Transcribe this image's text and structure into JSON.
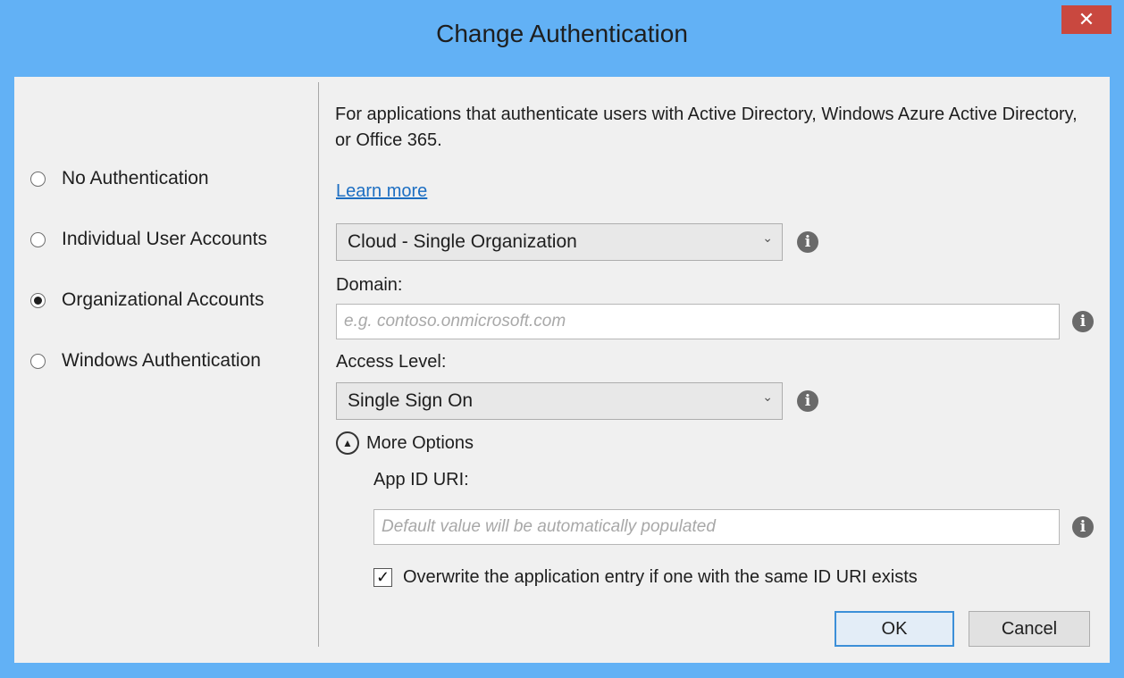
{
  "window": {
    "title": "Change Authentication",
    "close_glyph": "✕",
    "accent_color": "#62b1f5",
    "close_color": "#c9483f"
  },
  "auth_options": [
    {
      "label": "No Authentication",
      "checked": false
    },
    {
      "label": "Individual User Accounts",
      "checked": false
    },
    {
      "label": "Organizational Accounts",
      "checked": true
    },
    {
      "label": "Windows Authentication",
      "checked": false
    }
  ],
  "main": {
    "description": "For applications that authenticate users with Active Directory, Windows Azure Active Directory, or Office 365.",
    "learn_more": "Learn more",
    "org_type": "Cloud - Single Organization",
    "domain_label": "Domain:",
    "domain_placeholder": "e.g. contoso.onmicrosoft.com",
    "access_level_label": "Access Level:",
    "access_level": "Single Sign On",
    "more_options": "More Options",
    "app_id_uri_label": "App ID URI:",
    "app_id_uri_placeholder": "Default value will be automatically populated",
    "overwrite_label": "Overwrite the application entry if one with the same ID URI exists",
    "overwrite_checked": true,
    "info_glyph": "i",
    "dropdown_glyph": "⌄",
    "collapse_glyph": "▲",
    "check_glyph": "✓"
  },
  "buttons": {
    "ok": "OK",
    "cancel": "Cancel"
  }
}
